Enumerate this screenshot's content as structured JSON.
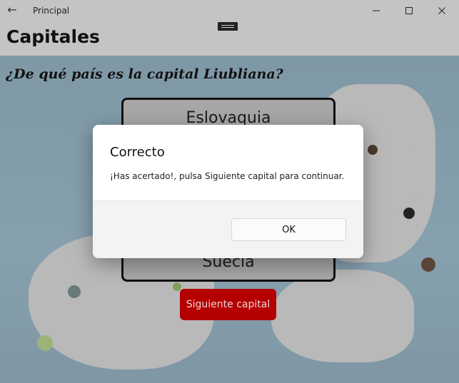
{
  "window": {
    "title": "Principal",
    "back_icon": "←",
    "minimize_icon": "minimize-icon",
    "maximize_icon": "maximize-icon",
    "close_icon": "close-icon"
  },
  "header": {
    "title": "Capitales"
  },
  "quiz": {
    "question": "¿De qué país es la capital Liubliana?",
    "answers": [
      "Eslovaquia",
      "Suecia"
    ],
    "next_label": "Siguiente capital"
  },
  "dialog": {
    "title": "Correcto",
    "message": "¡Has acertado!, pulsa Siguiente capital para continuar.",
    "ok_label": "OK"
  },
  "colors": {
    "next_button": "#b40000",
    "titlebar": "#c4c4c4",
    "dialog_footer": "#f3f3f3"
  }
}
